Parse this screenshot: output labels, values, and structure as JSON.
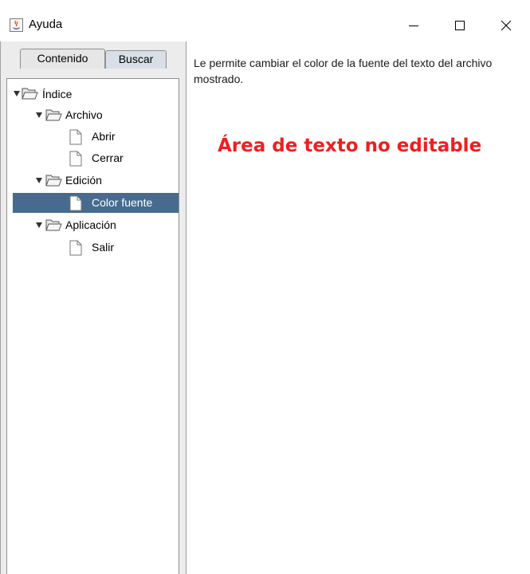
{
  "window": {
    "title": "Ayuda",
    "icon": "java-cup-icon",
    "controls": [
      "minimize-icon",
      "maximize-icon",
      "close-icon"
    ]
  },
  "tabs": [
    {
      "label": "Contenido",
      "selected": true
    },
    {
      "label": "Buscar",
      "selected": false
    }
  ],
  "tree": {
    "nodes": [
      {
        "label": "Índice",
        "type": "folder",
        "expanded": true
      },
      {
        "label": "Archivo",
        "type": "folder",
        "expanded": true
      },
      {
        "label": "Abrir",
        "type": "document"
      },
      {
        "label": "Cerrar",
        "type": "document"
      },
      {
        "label": "Edición",
        "type": "folder",
        "expanded": true
      },
      {
        "label": "Color fuente",
        "type": "document",
        "selected": true
      },
      {
        "label": "Aplicación",
        "type": "folder",
        "expanded": true
      },
      {
        "label": "Salir",
        "type": "document"
      }
    ]
  },
  "content": {
    "text": "Le permite cambiar el color de la fuente del texto del archivo mostrado.",
    "annotation": "Área de texto no editable",
    "annotation_color": "#ef1f1f"
  },
  "colors": {
    "selection": "#466b8f",
    "panel_bg": "#ececec"
  }
}
